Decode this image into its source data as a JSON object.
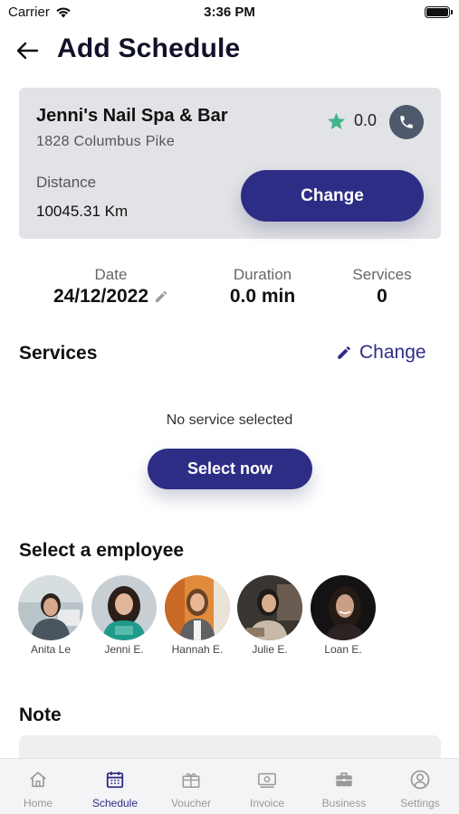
{
  "status_bar": {
    "carrier": "Carrier",
    "time": "3:36 PM"
  },
  "header": {
    "title": "Add Schedule"
  },
  "salon": {
    "name": "Jenni's Nail Spa & Bar",
    "address": "1828 Columbus Pike",
    "rating": "0.0",
    "distance_label": "Distance",
    "distance_value": "10045.31 Km",
    "change_label": "Change"
  },
  "summary": {
    "date_label": "Date",
    "date_value": "24/12/2022",
    "duration_label": "Duration",
    "duration_value": "0.0 min",
    "services_label": "Services",
    "services_value": "0"
  },
  "services": {
    "title": "Services",
    "change_label": "Change",
    "empty_text": "No service selected",
    "select_label": "Select now"
  },
  "employees": {
    "title": "Select a employee",
    "items": [
      {
        "name": "Anita Le"
      },
      {
        "name": "Jenni E."
      },
      {
        "name": "Hannah E."
      },
      {
        "name": "Julie E."
      },
      {
        "name": "Loan E."
      }
    ]
  },
  "note": {
    "title": "Note"
  },
  "tabs": [
    {
      "label": "Home",
      "icon": "home-icon"
    },
    {
      "label": "Schedule",
      "icon": "calendar-icon"
    },
    {
      "label": "Voucher",
      "icon": "voucher-icon"
    },
    {
      "label": "Invoice",
      "icon": "invoice-icon"
    },
    {
      "label": "Business",
      "icon": "briefcase-icon"
    },
    {
      "label": "Settings",
      "icon": "user-circle-icon"
    }
  ],
  "active_tab": "Schedule",
  "colors": {
    "primary": "#2e2d86",
    "star": "#3fb68b",
    "card_bg": "#e2e3e6",
    "phone_bg": "#4e5a6b"
  }
}
